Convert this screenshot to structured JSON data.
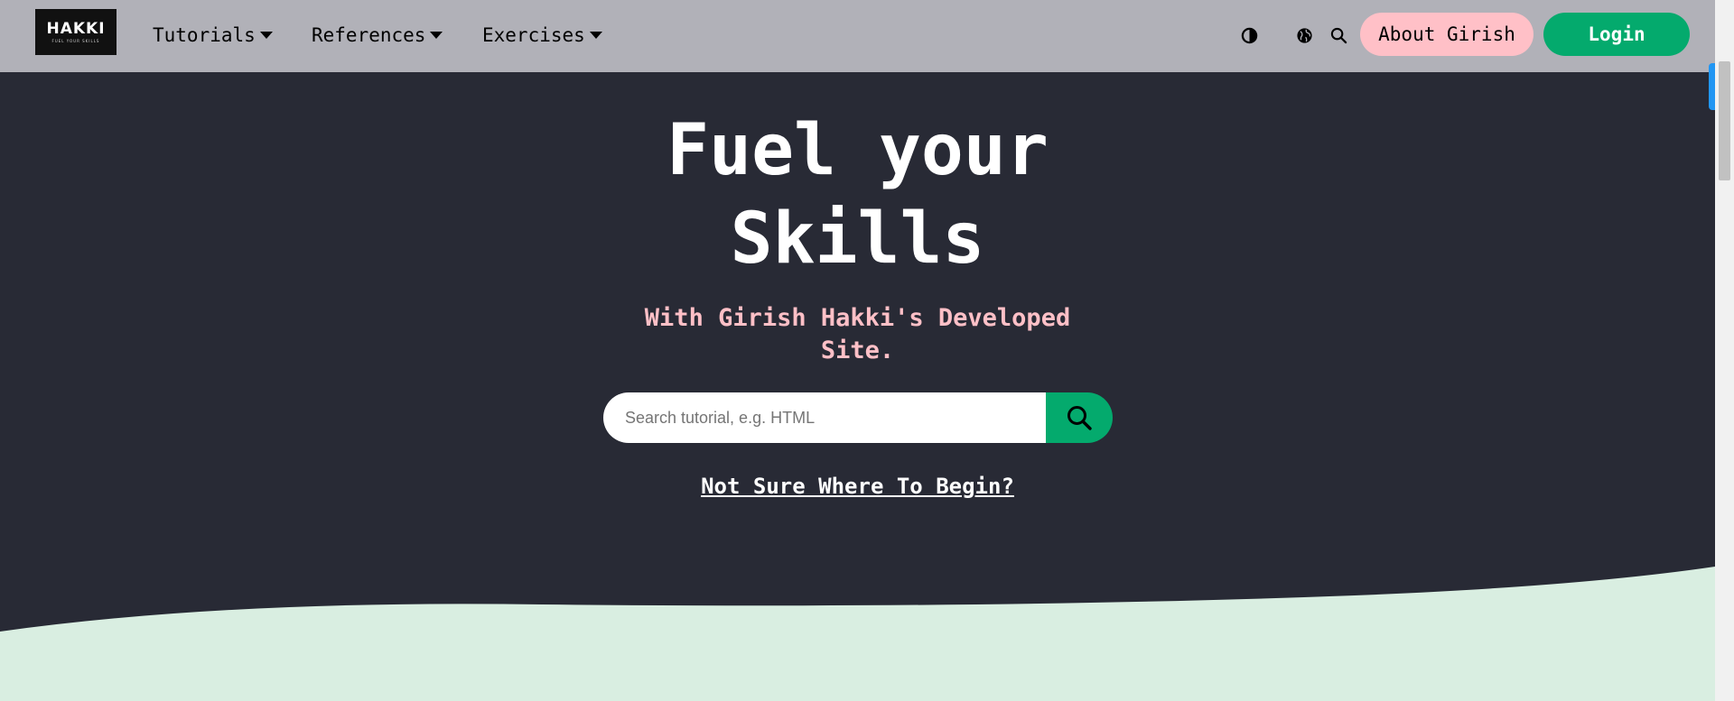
{
  "logo": {
    "main": "HAKKI",
    "sub": "FUEL YOUR SKILLS"
  },
  "nav": {
    "items": [
      {
        "label": "Tutorials"
      },
      {
        "label": "References"
      },
      {
        "label": "Exercises"
      }
    ],
    "icons": [
      "contrast-icon",
      "globe-icon",
      "search-icon"
    ],
    "about_label": "About Girish",
    "login_label": "Login"
  },
  "hero": {
    "title_line1": "Fuel your",
    "title_line2": "Skills",
    "subtitle_line1": "With Girish Hakki's Developed",
    "subtitle_line2": "Site.",
    "search_placeholder": "Search tutorial, e.g. HTML",
    "begin_link": "Not Sure Where To Begin?"
  },
  "colors": {
    "nav_bg": "#b1b1b8",
    "hero_bg": "#282a35",
    "accent_green": "#04aa6d",
    "accent_pink": "#ffc0c7",
    "wave": "#d9eee1"
  }
}
